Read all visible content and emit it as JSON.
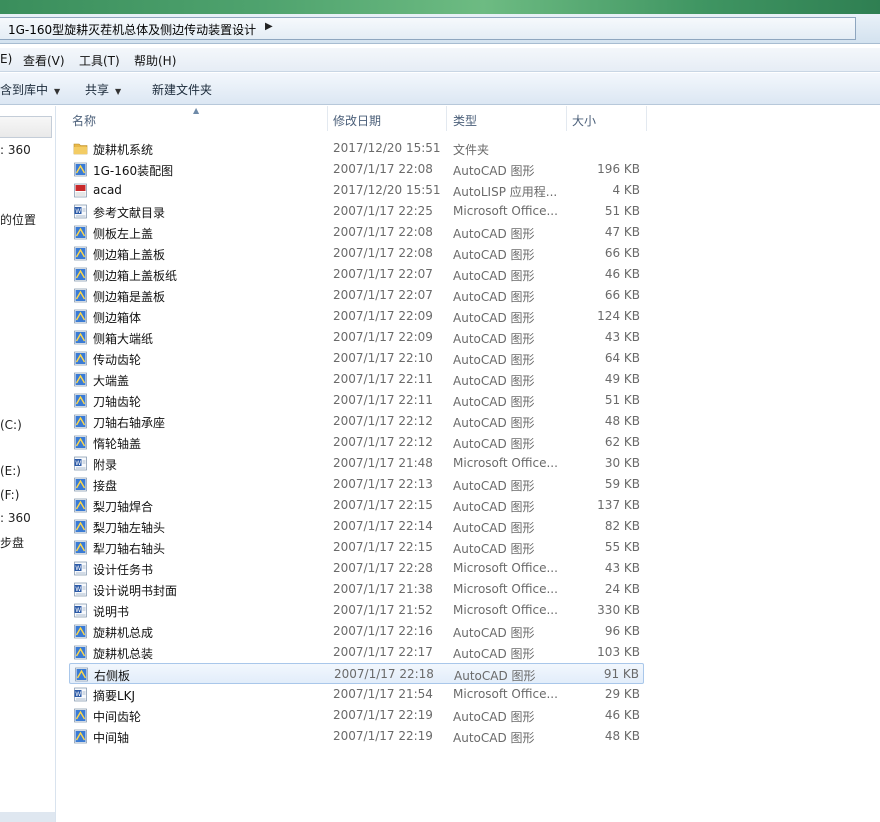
{
  "window": {
    "breadcrumb": "1G-160型旋耕灭茬机总体及侧边传动装置设计"
  },
  "menu": [
    {
      "label": "E)"
    },
    {
      "label": "查看(V)"
    },
    {
      "label": "工具(T)"
    },
    {
      "label": "帮助(H)"
    }
  ],
  "toolbar": {
    "include_library": "含到库中",
    "share": "共享",
    "new_folder": "新建文件夹"
  },
  "nav": {
    "items": [
      ": 360",
      "的位置",
      "(C:)",
      "(E:)",
      "(F:)",
      ": 360",
      "步盘"
    ]
  },
  "columns": {
    "name": "名称",
    "date": "修改日期",
    "type": "类型",
    "size": "大小"
  },
  "colors": {
    "folder": "#e8b84a",
    "autocad": "#3a7bd5",
    "word": "#2b5aa8",
    "lisp": "#c8282a",
    "selected_border": "#a9c7ea"
  },
  "files": [
    {
      "name": "旋耕机系统",
      "date": "2017/12/20 15:51",
      "type": "文件夹",
      "size": "",
      "icon": "folder-icon"
    },
    {
      "name": "1G-160装配图",
      "date": "2007/1/17 22:08",
      "type": "AutoCAD 图形",
      "size": "196 KB",
      "icon": "autocad-file-icon"
    },
    {
      "name": "acad",
      "date": "2017/12/20 15:51",
      "type": "AutoLISP 应用程...",
      "size": "4 KB",
      "icon": "lisp-file-icon"
    },
    {
      "name": "参考文献目录",
      "date": "2007/1/17 22:25",
      "type": "Microsoft Office...",
      "size": "51 KB",
      "icon": "word-file-icon"
    },
    {
      "name": "侧板左上盖",
      "date": "2007/1/17 22:08",
      "type": "AutoCAD 图形",
      "size": "47 KB",
      "icon": "autocad-file-icon"
    },
    {
      "name": "侧边箱上盖板",
      "date": "2007/1/17 22:08",
      "type": "AutoCAD 图形",
      "size": "66 KB",
      "icon": "autocad-file-icon"
    },
    {
      "name": "侧边箱上盖板纸",
      "date": "2007/1/17 22:07",
      "type": "AutoCAD 图形",
      "size": "46 KB",
      "icon": "autocad-file-icon"
    },
    {
      "name": "侧边箱是盖板",
      "date": "2007/1/17 22:07",
      "type": "AutoCAD 图形",
      "size": "66 KB",
      "icon": "autocad-file-icon"
    },
    {
      "name": "侧边箱体",
      "date": "2007/1/17 22:09",
      "type": "AutoCAD 图形",
      "size": "124 KB",
      "icon": "autocad-file-icon"
    },
    {
      "name": "侧箱大端纸",
      "date": "2007/1/17 22:09",
      "type": "AutoCAD 图形",
      "size": "43 KB",
      "icon": "autocad-file-icon"
    },
    {
      "name": "传动齿轮",
      "date": "2007/1/17 22:10",
      "type": "AutoCAD 图形",
      "size": "64 KB",
      "icon": "autocad-file-icon"
    },
    {
      "name": "大端盖",
      "date": "2007/1/17 22:11",
      "type": "AutoCAD 图形",
      "size": "49 KB",
      "icon": "autocad-file-icon"
    },
    {
      "name": "刀轴齿轮",
      "date": "2007/1/17 22:11",
      "type": "AutoCAD 图形",
      "size": "51 KB",
      "icon": "autocad-file-icon"
    },
    {
      "name": "刀轴右轴承座",
      "date": "2007/1/17 22:12",
      "type": "AutoCAD 图形",
      "size": "48 KB",
      "icon": "autocad-file-icon"
    },
    {
      "name": "惰轮轴盖",
      "date": "2007/1/17 22:12",
      "type": "AutoCAD 图形",
      "size": "62 KB",
      "icon": "autocad-file-icon"
    },
    {
      "name": "附录",
      "date": "2007/1/17 21:48",
      "type": "Microsoft Office...",
      "size": "30 KB",
      "icon": "word-file-icon"
    },
    {
      "name": "接盘",
      "date": "2007/1/17 22:13",
      "type": "AutoCAD 图形",
      "size": "59 KB",
      "icon": "autocad-file-icon"
    },
    {
      "name": "梨刀轴焊合",
      "date": "2007/1/17 22:15",
      "type": "AutoCAD 图形",
      "size": "137 KB",
      "icon": "autocad-file-icon"
    },
    {
      "name": "梨刀轴左轴头",
      "date": "2007/1/17 22:14",
      "type": "AutoCAD 图形",
      "size": "82 KB",
      "icon": "autocad-file-icon"
    },
    {
      "name": "犁刀轴右轴头",
      "date": "2007/1/17 22:15",
      "type": "AutoCAD 图形",
      "size": "55 KB",
      "icon": "autocad-file-icon"
    },
    {
      "name": "设计任务书",
      "date": "2007/1/17 22:28",
      "type": "Microsoft Office...",
      "size": "43 KB",
      "icon": "word-file-icon"
    },
    {
      "name": "设计说明书封面",
      "date": "2007/1/17 21:38",
      "type": "Microsoft Office...",
      "size": "24 KB",
      "icon": "word-file-icon"
    },
    {
      "name": "说明书",
      "date": "2007/1/17 21:52",
      "type": "Microsoft Office...",
      "size": "330 KB",
      "icon": "word-file-icon"
    },
    {
      "name": "旋耕机总成",
      "date": "2007/1/17 22:16",
      "type": "AutoCAD 图形",
      "size": "96 KB",
      "icon": "autocad-file-icon"
    },
    {
      "name": "旋耕机总装",
      "date": "2007/1/17 22:17",
      "type": "AutoCAD 图形",
      "size": "103 KB",
      "icon": "autocad-file-icon"
    },
    {
      "name": "右侧板",
      "date": "2007/1/17 22:18",
      "type": "AutoCAD 图形",
      "size": "91 KB",
      "icon": "autocad-file-icon",
      "selected": true
    },
    {
      "name": "摘要LKJ",
      "date": "2007/1/17 21:54",
      "type": "Microsoft Office...",
      "size": "29 KB",
      "icon": "word-file-icon"
    },
    {
      "name": "中间齿轮",
      "date": "2007/1/17 22:19",
      "type": "AutoCAD 图形",
      "size": "46 KB",
      "icon": "autocad-file-icon"
    },
    {
      "name": "中间轴",
      "date": "2007/1/17 22:19",
      "type": "AutoCAD 图形",
      "size": "48 KB",
      "icon": "autocad-file-icon"
    }
  ]
}
